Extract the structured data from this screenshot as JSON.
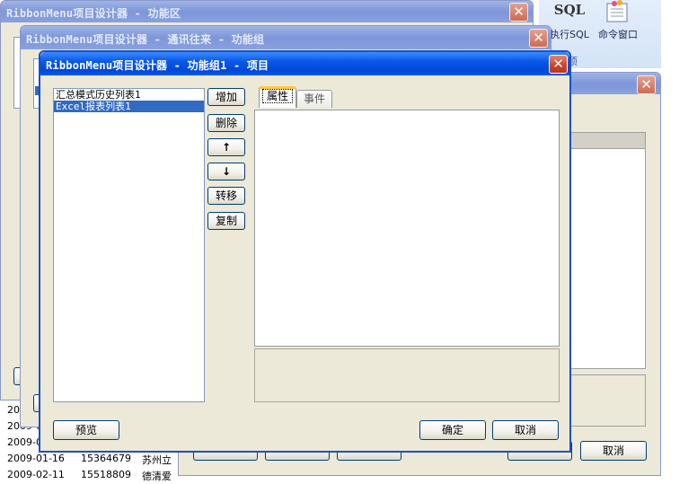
{
  "ribbon": {
    "sql_label": "SQL",
    "exec_sql_label": "执行SQL",
    "cmd_window_label": "命令窗口",
    "group_partial": "项"
  },
  "background_table": {
    "rows": [
      {
        "date": "20",
        "code": "",
        "name": ""
      },
      {
        "date": "2009-0",
        "code": "",
        "name": ""
      },
      {
        "date": "2009-0",
        "code": "",
        "name": ""
      },
      {
        "date": "2009-01-16",
        "code": "15364679",
        "name": "苏州立"
      },
      {
        "date": "2009-02-11",
        "code": "15518809",
        "name": "德清爱"
      }
    ]
  },
  "window_func_area": {
    "title": "RibbonMenu项目设计器 - 功能区"
  },
  "window_func_group": {
    "title": "RibbonMenu项目设计器 - 通讯往来 - 功能组"
  },
  "right_dialog": {
    "cancel_label": "取消"
  },
  "main_dialog": {
    "title": "RibbonMenu项目设计器 - 功能组1 - 项目",
    "items": [
      {
        "label": "汇总模式历史列表1",
        "selected": false
      },
      {
        "label": "Excel报表列表1",
        "selected": true
      }
    ],
    "buttons": {
      "add": "增加",
      "delete": "删除",
      "up": "↑",
      "down": "↓",
      "move": "转移",
      "copy": "复制"
    },
    "tabs": [
      {
        "label": "属性",
        "active": true
      },
      {
        "label": "事件",
        "active": false
      }
    ],
    "footer": {
      "preview": "预览",
      "ok": "确定",
      "cancel": "取消"
    }
  }
}
